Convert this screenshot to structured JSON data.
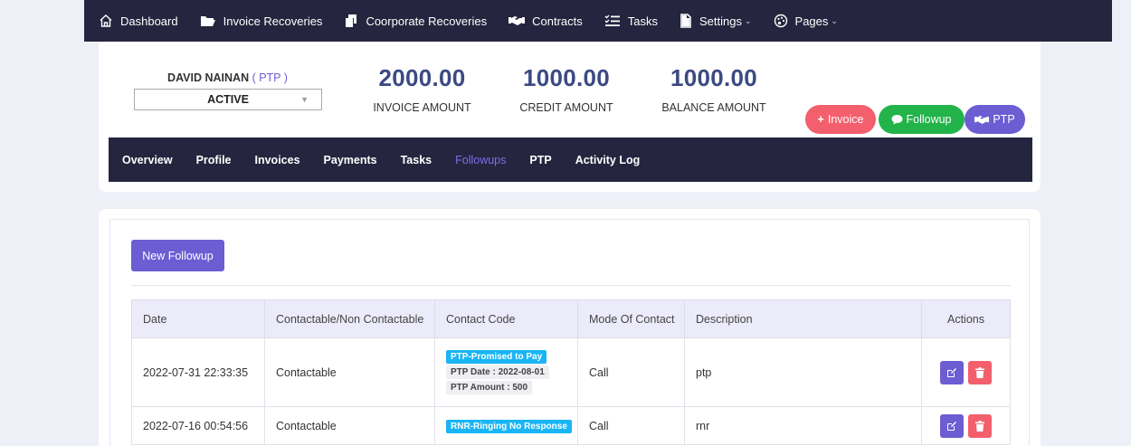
{
  "nav": {
    "items": [
      {
        "label": "Dashboard",
        "icon": "home-icon",
        "dropdown": false
      },
      {
        "label": "Invoice Recoveries",
        "icon": "folder-icon",
        "dropdown": false
      },
      {
        "label": "Coorporate Recoveries",
        "icon": "copy-icon",
        "dropdown": false
      },
      {
        "label": "Contracts",
        "icon": "handshake-icon",
        "dropdown": false
      },
      {
        "label": "Tasks",
        "icon": "list-check-icon",
        "dropdown": false
      },
      {
        "label": "Settings",
        "icon": "file-icon",
        "dropdown": true
      },
      {
        "label": "Pages",
        "icon": "palette-icon",
        "dropdown": true
      }
    ],
    "dropdown_glyph": "⌄"
  },
  "client": {
    "name": "DAVID NAINAN",
    "tag": "( PTP )",
    "status": "ACTIVE"
  },
  "amounts": {
    "invoice": {
      "value": "2000.00",
      "label": "INVOICE AMOUNT"
    },
    "credit": {
      "value": "1000.00",
      "label": "CREDIT AMOUNT"
    },
    "balance": {
      "value": "1000.00",
      "label": "BALANCE AMOUNT"
    }
  },
  "actions": {
    "invoice": "Invoice",
    "followup": "Followup",
    "ptp": "PTP"
  },
  "tabs": [
    {
      "label": "Overview",
      "active": false
    },
    {
      "label": "Profile",
      "active": false
    },
    {
      "label": "Invoices",
      "active": false
    },
    {
      "label": "Payments",
      "active": false
    },
    {
      "label": "Tasks",
      "active": false
    },
    {
      "label": "Followups",
      "active": true
    },
    {
      "label": "PTP",
      "active": false
    },
    {
      "label": "Activity Log",
      "active": false
    }
  ],
  "followups": {
    "new_button": "New Followup",
    "columns": [
      "Date",
      "Contactable/Non Contactable",
      "Contact Code",
      "Mode Of Contact",
      "Description",
      "Actions"
    ],
    "rows": [
      {
        "date": "2022-07-31 22:33:35",
        "contactable": "Contactable",
        "code": "PTP-Promised to Pay",
        "ptp_date": "PTP Date : 2022-08-01",
        "ptp_amount": "PTP Amount : 500",
        "mode": "Call",
        "description": "ptp"
      },
      {
        "date": "2022-07-16 00:54:56",
        "contactable": "Contactable",
        "code": "RNR-Ringing No Response",
        "mode": "Call",
        "description": "rnr"
      }
    ]
  },
  "colors": {
    "nav_bg": "#25253f",
    "accent": "#6c5dd3",
    "amount": "#3b4a82",
    "danger": "#f35f6c",
    "success": "#22b34a",
    "badge": "#19b5f5"
  }
}
